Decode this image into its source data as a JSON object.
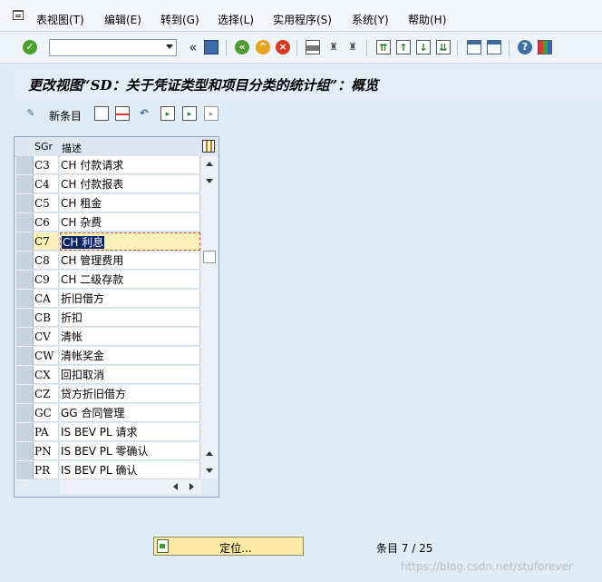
{
  "menu": {
    "items": [
      {
        "label": "表视图(T)"
      },
      {
        "label": "编辑(E)"
      },
      {
        "label": "转到(G)"
      },
      {
        "label": "选择(L)"
      },
      {
        "label": "实用程序(S)"
      },
      {
        "label": "系统(Y)"
      },
      {
        "label": "帮助(H)"
      }
    ]
  },
  "toolbar": {
    "command_field_value": "",
    "collapse_glyph": "«"
  },
  "title": "更改视图“SD：关于凭证类型和项目分类的统计组”：概览",
  "app_toolbar": {
    "new_entries_label": "新条目"
  },
  "table": {
    "headers": {
      "col1": "SGr",
      "col2": "描述"
    },
    "selected_row_index": 4,
    "rows": [
      {
        "code": "C3",
        "desc": "CH 付款请求"
      },
      {
        "code": "C4",
        "desc": "CH 付款报表"
      },
      {
        "code": "C5",
        "desc": "CH 租金"
      },
      {
        "code": "C6",
        "desc": "CH 杂费"
      },
      {
        "code": "C7",
        "desc": "CH 利息"
      },
      {
        "code": "C8",
        "desc": "CH 管理费用"
      },
      {
        "code": "C9",
        "desc": "CH 二级存款"
      },
      {
        "code": "CA",
        "desc": "折旧借方"
      },
      {
        "code": "CB",
        "desc": "折扣"
      },
      {
        "code": "CV",
        "desc": "清帐"
      },
      {
        "code": "CW",
        "desc": "清帐奖金"
      },
      {
        "code": "CX",
        "desc": "回扣取消"
      },
      {
        "code": "CZ",
        "desc": "贷方折旧借方"
      },
      {
        "code": "GC",
        "desc": "GG 合同管理"
      },
      {
        "code": "PA",
        "desc": "IS BEV PL 请求"
      },
      {
        "code": "PN",
        "desc": "IS BEV PL 零确认"
      },
      {
        "code": "PR",
        "desc": "IS BEV PL 确认"
      }
    ]
  },
  "position_button": {
    "label": "定位..."
  },
  "entry_count": "条目 7 / 25",
  "watermark": "https://blog.csdn.net/stuforever",
  "colors": {
    "background": "#dfebf5",
    "highlight_row": "#fcf2b9",
    "position_button": "#fbe9a4"
  }
}
